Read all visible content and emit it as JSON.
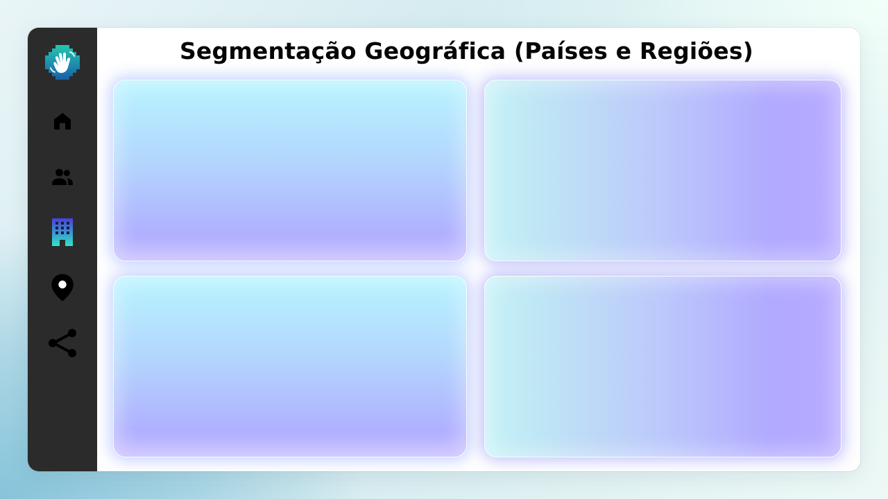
{
  "page": {
    "title": "Segmentação Geográfica (Países e Regiões)"
  },
  "sidebar": {
    "logo_icon": "waving-hand-logo",
    "items": [
      {
        "icon": "home-icon",
        "active": false
      },
      {
        "icon": "people-icon",
        "active": false
      },
      {
        "icon": "building-icon",
        "active": true
      },
      {
        "icon": "location-pin-icon",
        "active": false
      },
      {
        "icon": "share-icon",
        "active": false
      }
    ]
  },
  "panels": [
    {
      "id": "panel-1",
      "content": ""
    },
    {
      "id": "panel-2",
      "content": ""
    },
    {
      "id": "panel-3",
      "content": ""
    },
    {
      "id": "panel-4",
      "content": ""
    }
  ],
  "colors": {
    "sidebar_bg": "#2b2b2b",
    "accent_cyan": "#2ee6c8",
    "accent_indigo": "#4a3fd8",
    "panel_light": "#b7f4ff",
    "panel_violet": "#b0b0ff"
  }
}
